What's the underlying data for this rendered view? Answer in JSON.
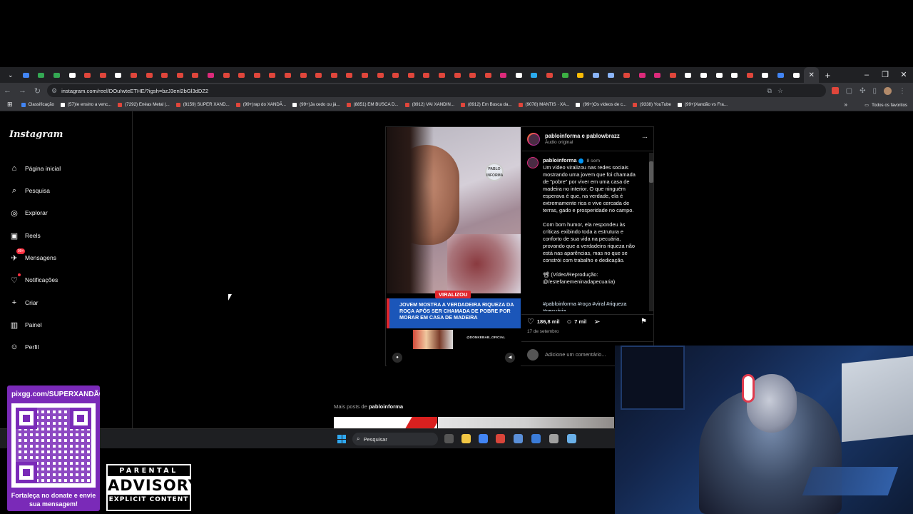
{
  "browser": {
    "url": "instagram.com/reel/DOuIwteETHE/?igsh=bzJ3enl2bGl3dDZ2",
    "tab_colors": [
      "#4285f4",
      "#34a853",
      "#34a853",
      "#ffffff",
      "#e0463b",
      "#e0463b",
      "#ffffff",
      "#e0463b",
      "#e0463b",
      "#e0463b",
      "#e0463b",
      "#e0463b",
      "#dd2a7b",
      "#e0463b",
      "#e0463b",
      "#e0463b",
      "#e0463b",
      "#e0463b",
      "#e0463b",
      "#e0463b",
      "#e0463b",
      "#e0463b",
      "#e0463b",
      "#e0463b",
      "#e0463b",
      "#e0463b",
      "#e0463b",
      "#e0463b",
      "#e0463b",
      "#e0463b",
      "#e0463b",
      "#dd2a7b",
      "#ffffff",
      "#2aabee",
      "#e0463b",
      "#3cb043",
      "#fbbc05",
      "#8ab4f8",
      "#8ab4f8",
      "#e0463b",
      "#dd2a7b",
      "#dd2a7b",
      "#e0463b",
      "#ffffff",
      "#ffffff",
      "#ffffff",
      "#ffffff",
      "#e0463b",
      "#ffffff",
      "#4285f4",
      "#ffffff"
    ],
    "new_tab": "+",
    "close_tab": "✕",
    "window_controls": [
      "–",
      "❐",
      "✕"
    ],
    "bookmarks": [
      {
        "label": "Classificação",
        "color": "#4285f4"
      },
      {
        "label": "(57)Ie ensino a venc...",
        "color": "#ffffff"
      },
      {
        "label": "(7292) Enéas Metal |...",
        "color": "#e0463b"
      },
      {
        "label": "(8159) SUPER XAND...",
        "color": "#e0463b"
      },
      {
        "label": "(99+)rap do XANDÃ...",
        "color": "#e0463b"
      },
      {
        "label": "(99+)Ja cedo ou já...",
        "color": "#ffffff"
      },
      {
        "label": "(8851) EM BUSCA D...",
        "color": "#e0463b"
      },
      {
        "label": "(8912) VAI XANDIN...",
        "color": "#e0463b"
      },
      {
        "label": "(8912) Em Busca da...",
        "color": "#e0463b"
      },
      {
        "label": "(9078) MANTIS · XA...",
        "color": "#e0463b"
      },
      {
        "label": "(99+)Os videos de c...",
        "color": "#ffffff"
      },
      {
        "label": "(9338) YouTube",
        "color": "#e0463b"
      },
      {
        "label": "(99+)Xandão vs Fra...",
        "color": "#ffffff"
      }
    ],
    "bookmarks_more": "»",
    "all_bookmarks": "Todos os favoritos"
  },
  "instagram": {
    "logo": "Instagram",
    "nav": [
      {
        "icon": "⌂",
        "label": "Página inicial"
      },
      {
        "icon": "⌕",
        "label": "Pesquisa"
      },
      {
        "icon": "◎",
        "label": "Explorar"
      },
      {
        "icon": "▣",
        "label": "Reels"
      },
      {
        "icon": "✈",
        "label": "Mensagens",
        "badge": "99+"
      },
      {
        "icon": "♡",
        "label": "Notificações"
      },
      {
        "icon": "+",
        "label": "Criar"
      },
      {
        "icon": "▥",
        "label": "Painel"
      },
      {
        "icon": "☺",
        "label": "Perfil"
      }
    ],
    "post": {
      "header_title": "pabloinforma e pablowbrazz",
      "header_sub": "Áudio original",
      "more": "···",
      "video_logo": "PABLO INFORMA",
      "viral_tag": "VIRALIZOU",
      "video_caption": "JOVEM MOSTRA A VERDADEIRA RIQUEZA DA ROÇA APÓS SER CHAMADA DE POBRE POR MORAR EM CASA DE MADEIRA",
      "promo_text": "@DONKEBAB_OFICIAL",
      "caption_user": "pabloinforma",
      "caption_time": "8 sem",
      "caption_text": "Um vídeo viralizou nas redes sociais mostrando uma jovem que foi chamada de \"pobre\" por viver em uma casa de madeira no interior. O que ninguém esperava é que, na verdade, ela é extremamente rica e vive cercada de terras, gado e prosperidade no campo.\n\nCom bom humor, ela respondeu às críticas exibindo toda a estrutura e conforto de sua vida na pecuária, provando que a verdadeira riqueza não está nas aparências, mas no que se constrói com trabalho e dedicação.\n\n📽 (Vídeo/Reprodução: @/estefanemeninadapecuaria)",
      "caption_tags": "#pabloinforma #roça #viral #riqueza #pecuária",
      "likes": "186,8 mil",
      "comments": "7 mil",
      "date": "17 de setembro",
      "comment_placeholder": "Adicione um comentário..."
    },
    "more_posts_prefix": "Mais posts de",
    "more_posts_user": "pabloinforma"
  },
  "taskbar": {
    "search_label": "Pesquisar",
    "app_colors": [
      "#555555",
      "#f2c744",
      "#4285f4",
      "#d9453a",
      "#5a8fd8",
      "#3b7cd8",
      "#a0a0a0",
      "#6ab0e8"
    ]
  },
  "overlay": {
    "qr_title": "pixgg.com/SUPERXANDÃO",
    "qr_text": "Fortaleça no donate e envie sua mensagem!",
    "advisory_top": "PARENTAL",
    "advisory_mid": "ADVISORY",
    "advisory_bot": "EXPLICIT CONTENT"
  }
}
